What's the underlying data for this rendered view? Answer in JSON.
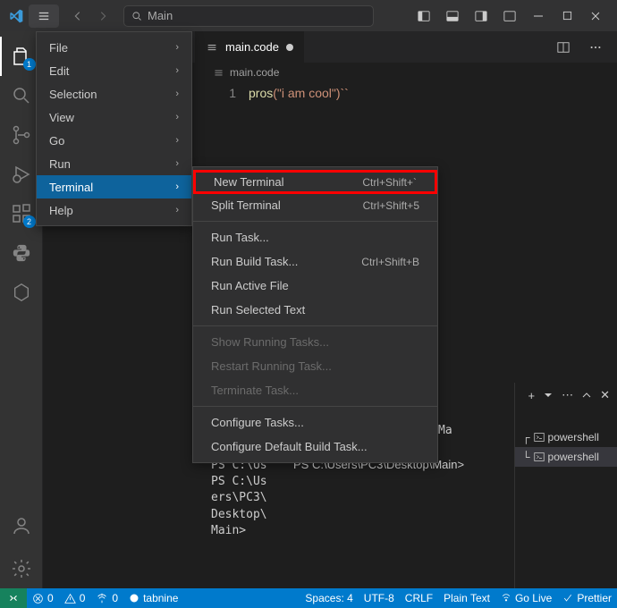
{
  "titlebar": {
    "search_label": "Main"
  },
  "tab": {
    "filename": "main.code"
  },
  "breadcrumb": {
    "filename": "main.code"
  },
  "editor": {
    "line_number": "1",
    "code_fn": "pros",
    "code_args": "(\"i am cool\")``"
  },
  "mainmenu": [
    {
      "label": "File",
      "submenu": true
    },
    {
      "label": "Edit",
      "submenu": true
    },
    {
      "label": "Selection",
      "submenu": true
    },
    {
      "label": "View",
      "submenu": true
    },
    {
      "label": "Go",
      "submenu": true
    },
    {
      "label": "Run",
      "submenu": true
    },
    {
      "label": "Terminal",
      "submenu": true,
      "hover": true
    },
    {
      "label": "Help",
      "submenu": true
    }
  ],
  "submenu": {
    "items": [
      {
        "label": "New Terminal",
        "shortcut": "Ctrl+Shift+`",
        "highlight": true
      },
      {
        "label": "Split Terminal",
        "shortcut": "Ctrl+Shift+5"
      }
    ],
    "group2": [
      {
        "label": "Run Task..."
      },
      {
        "label": "Run Build Task...",
        "shortcut": "Ctrl+Shift+B"
      },
      {
        "label": "Run Active File"
      },
      {
        "label": "Run Selected Text"
      }
    ],
    "group3": [
      {
        "label": "Show Running Tasks...",
        "disabled": true
      },
      {
        "label": "Restart Running Task...",
        "disabled": true
      },
      {
        "label": "Terminate Task...",
        "disabled": true
      }
    ],
    "group4": [
      {
        "label": "Configure Tasks..."
      },
      {
        "label": "Configure Default Build Task..."
      }
    ]
  },
  "terminal": {
    "left_text": "PS C:\\Us\nPS C:\\Us\ners\\PC3\\\nDesktop\\\nMain>",
    "center_text": "PS C:\\Users\\PC3\\Desktop\\Main>",
    "truncated": "Ma",
    "tabs": [
      {
        "label": "powershell",
        "prefix": "┌"
      },
      {
        "label": "powershell",
        "prefix": "└",
        "active": true
      }
    ]
  },
  "activity_badges": {
    "explorer": "1",
    "extensions": "2"
  },
  "statusbar": {
    "errors": "0",
    "warnings": "0",
    "ports": "0",
    "tabnine": "tabnine",
    "spaces": "Spaces: 4",
    "encoding": "UTF-8",
    "eol": "CRLF",
    "lang": "Plain Text",
    "golive": "Go Live",
    "prettier": "Prettier"
  }
}
